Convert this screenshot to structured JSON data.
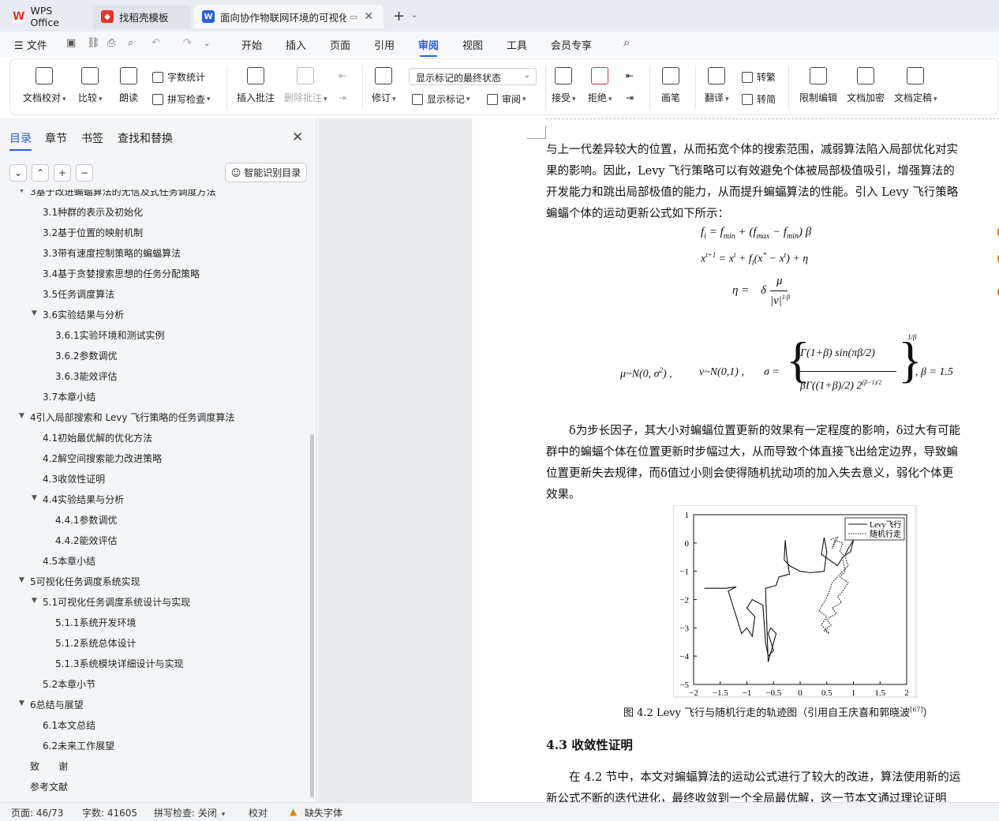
{
  "tabs": [
    {
      "label": "WPS Office",
      "icon": "wps-logo-icon"
    },
    {
      "label": "找稻壳模板",
      "icon": "docer-icon"
    },
    {
      "label": "面向协作物联网环境的可视化",
      "icon": "wps-writer-icon"
    }
  ],
  "tab_new": "+",
  "menu": {
    "file": "文件",
    "items": [
      "开始",
      "插入",
      "页面",
      "引用",
      "审阅",
      "视图",
      "工具",
      "会员专享"
    ],
    "active": "审阅"
  },
  "ribbon": {
    "doc_check": "文档校对",
    "compare": "比较",
    "read_aloud": "朗读",
    "word_count": "字数统计",
    "spell_check": "拼写检查",
    "insert_comment": "插入批注",
    "delete_comment": "删除批注",
    "revise": "修订",
    "markup_state": "显示标记的最终状态",
    "show_markup": "显示标记",
    "review_pane": "审阅",
    "accept": "接受",
    "reject": "拒绝",
    "pen": "画笔",
    "translate": "翻译",
    "trad": "转繁",
    "simp": "转简",
    "restrict_edit": "限制编辑",
    "encrypt": "文档加密",
    "finalize": "文档定稿"
  },
  "panel": {
    "tabs": [
      "目录",
      "章节",
      "书签",
      "查找和替换"
    ],
    "smart_btn": "智能识别目录",
    "toc": [
      {
        "text": "3基于改进蝙蝠算法的无信及式任务调度方法",
        "level": 1,
        "arrow": true
      },
      {
        "text": "3.1种群的表示及初始化",
        "level": 2
      },
      {
        "text": "3.2基于位置的映射机制",
        "level": 2
      },
      {
        "text": "3.3带有速度控制策略的蝙蝠算法",
        "level": 2
      },
      {
        "text": "3.4基于贪婪搜索思想的任务分配策略",
        "level": 2
      },
      {
        "text": "3.5任务调度算法",
        "level": 2
      },
      {
        "text": "3.6实验结果与分析",
        "level": 2,
        "arrow": true
      },
      {
        "text": "3.6.1实验环境和测试实例",
        "level": 3
      },
      {
        "text": "3.6.2参数调优",
        "level": 3
      },
      {
        "text": "3.6.3能效评估",
        "level": 3
      },
      {
        "text": "3.7本章小结",
        "level": 2
      },
      {
        "text": "4引入局部搜索和 Levy 飞行策略的任务调度算法",
        "level": 1,
        "arrow": true
      },
      {
        "text": "4.1初始最优解的优化方法",
        "level": 2
      },
      {
        "text": "4.2解空间搜索能力改进策略",
        "level": 2
      },
      {
        "text": "4.3收敛性证明",
        "level": 2
      },
      {
        "text": "4.4实验结果与分析",
        "level": 2,
        "arrow": true
      },
      {
        "text": "4.4.1参数调优",
        "level": 3
      },
      {
        "text": "4.4.2能效评估",
        "level": 3
      },
      {
        "text": "4.5本章小结",
        "level": 2
      },
      {
        "text": "5可视化任务调度系统实现",
        "level": 1,
        "arrow": true
      },
      {
        "text": "5.1可视化任务调度系统设计与实现",
        "level": 2,
        "arrow": true
      },
      {
        "text": "5.1.1系统开发环境",
        "level": 3
      },
      {
        "text": "5.1.2系统总体设计",
        "level": 3
      },
      {
        "text": "5.1.3系统模块详细设计与实现",
        "level": 3
      },
      {
        "text": "5.2本章小节",
        "level": 2
      },
      {
        "text": "6总结与展望",
        "level": 1,
        "arrow": true
      },
      {
        "text": "6.1本文总结",
        "level": 2
      },
      {
        "text": "6.2未来工作展望",
        "level": 2
      },
      {
        "text": "致　　谢",
        "level": 1
      },
      {
        "text": "参考文献",
        "level": 1
      }
    ]
  },
  "doc": {
    "p1": [
      "与上一代差异较大的位置，从而拓宽个体的搜索范围，减弱算法陷入局部优化对实",
      "果的影响。因此，Levy 飞行策略可以有效避免个体被局部极值吸引，增强算法的",
      "开发能力和跳出局部极值的能力，从而提升蝙蝠算法的性能。引入 Levy 飞行策略",
      "蝙蝠个体的运动更新公式如下所示："
    ],
    "p2": [
      "δ为步长因子，其大小对蝙蝠位置更新的效果有一定程度的影响，δ过大有可能",
      "群中的蝙蝠个体在位置更新时步幅过大，从而导致个体直接飞出给定边界，导致蝙",
      "位置更新失去规律，而δ值过小则会使得随机扰动项的加入失去意义，弱化个体更",
      "效果。"
    ],
    "caption": "图 4.2 Levy 飞行与随机行走的轨迹图（引用自王庆喜和郭晓波",
    "caption_ref": "[67]",
    "caption_end": "）",
    "heading": "4.3  收敛性证明",
    "p3": [
      "在 4.2 节中，本文对蝙蝠算法的运动公式进行了较大的改进，算法使用新的运",
      "新公式不断的迭代进化，最终收敛到一个全局最优解，这一节本文通过理论证明"
    ]
  },
  "chart_data": {
    "type": "line",
    "xlim": [
      -2,
      2
    ],
    "ylim": [
      -5,
      1
    ],
    "xticks": [
      "−2",
      "−1.5",
      "−1",
      "−0.5",
      "0",
      "0.5",
      "1",
      "1.5",
      "2"
    ],
    "yticks": [
      "1",
      "0",
      "−1",
      "−2",
      "−3",
      "−4",
      "−5"
    ],
    "legend_position": "top-right",
    "series": [
      {
        "name": "Levy飞行",
        "style": "solid",
        "x": [
          -1.8,
          -1.4,
          -1.2,
          -1.35,
          -1.1,
          -1.0,
          -0.9,
          -0.85,
          -1.0,
          -0.9,
          -0.7,
          -0.65,
          -0.6,
          -0.5,
          -0.6,
          -0.55,
          -0.45,
          -0.6,
          -0.65,
          -0.45,
          -0.4,
          -0.2,
          -0.25,
          -0.28,
          -0.3,
          -0.2,
          0.0,
          0.2,
          0.45,
          0.5,
          0.45,
          0.4,
          0.55,
          0.7,
          0.8,
          0.95,
          1.0,
          0.9,
          0.85
        ],
        "y": [
          -1.6,
          -1.6,
          -1.55,
          -1.7,
          -3.2,
          -3.0,
          -3.3,
          -2.6,
          -2.3,
          -2.0,
          -2.2,
          -3.5,
          -4.0,
          -3.8,
          -3.2,
          -3.0,
          -3.2,
          -4.2,
          -1.6,
          -1.5,
          -1.2,
          -1.1,
          -0.5,
          0.1,
          -0.6,
          -0.8,
          -1.0,
          -1.05,
          -1.0,
          -0.3,
          0.2,
          -0.4,
          -0.6,
          -0.8,
          -0.5,
          -0.3,
          0.1,
          -0.2,
          -0.4
        ]
      },
      {
        "name": "随机行走",
        "style": "dotted",
        "x": [
          0.8,
          0.85,
          0.75,
          0.9,
          0.8,
          0.7,
          0.78,
          0.6,
          0.68,
          0.5,
          0.58,
          0.45,
          0.55,
          0.4,
          0.5,
          0.35,
          0.48,
          0.55,
          0.6,
          0.7,
          0.8,
          0.9,
          0.85,
          0.75,
          0.8,
          0.65,
          0.6,
          0.7,
          0.55
        ],
        "y": [
          -0.6,
          -1.0,
          -1.2,
          -1.4,
          -1.7,
          -1.9,
          -2.1,
          -2.3,
          -2.5,
          -2.7,
          -2.9,
          -3.1,
          -3.2,
          -2.9,
          -2.6,
          -2.4,
          -2.0,
          -1.7,
          -1.4,
          -1.2,
          -1.0,
          -0.8,
          -0.5,
          -0.3,
          0.0,
          0.1,
          -0.2,
          0.2,
          0.1
        ]
      }
    ]
  },
  "status": {
    "page": "页面: 46/73",
    "words": "字数: 41605",
    "spell": "拼写检查: 关闭",
    "proof": "校对",
    "missing_font": "缺失字体"
  },
  "colors": {
    "accent": "#2b5fd9",
    "wps_red": "#e5322d"
  }
}
